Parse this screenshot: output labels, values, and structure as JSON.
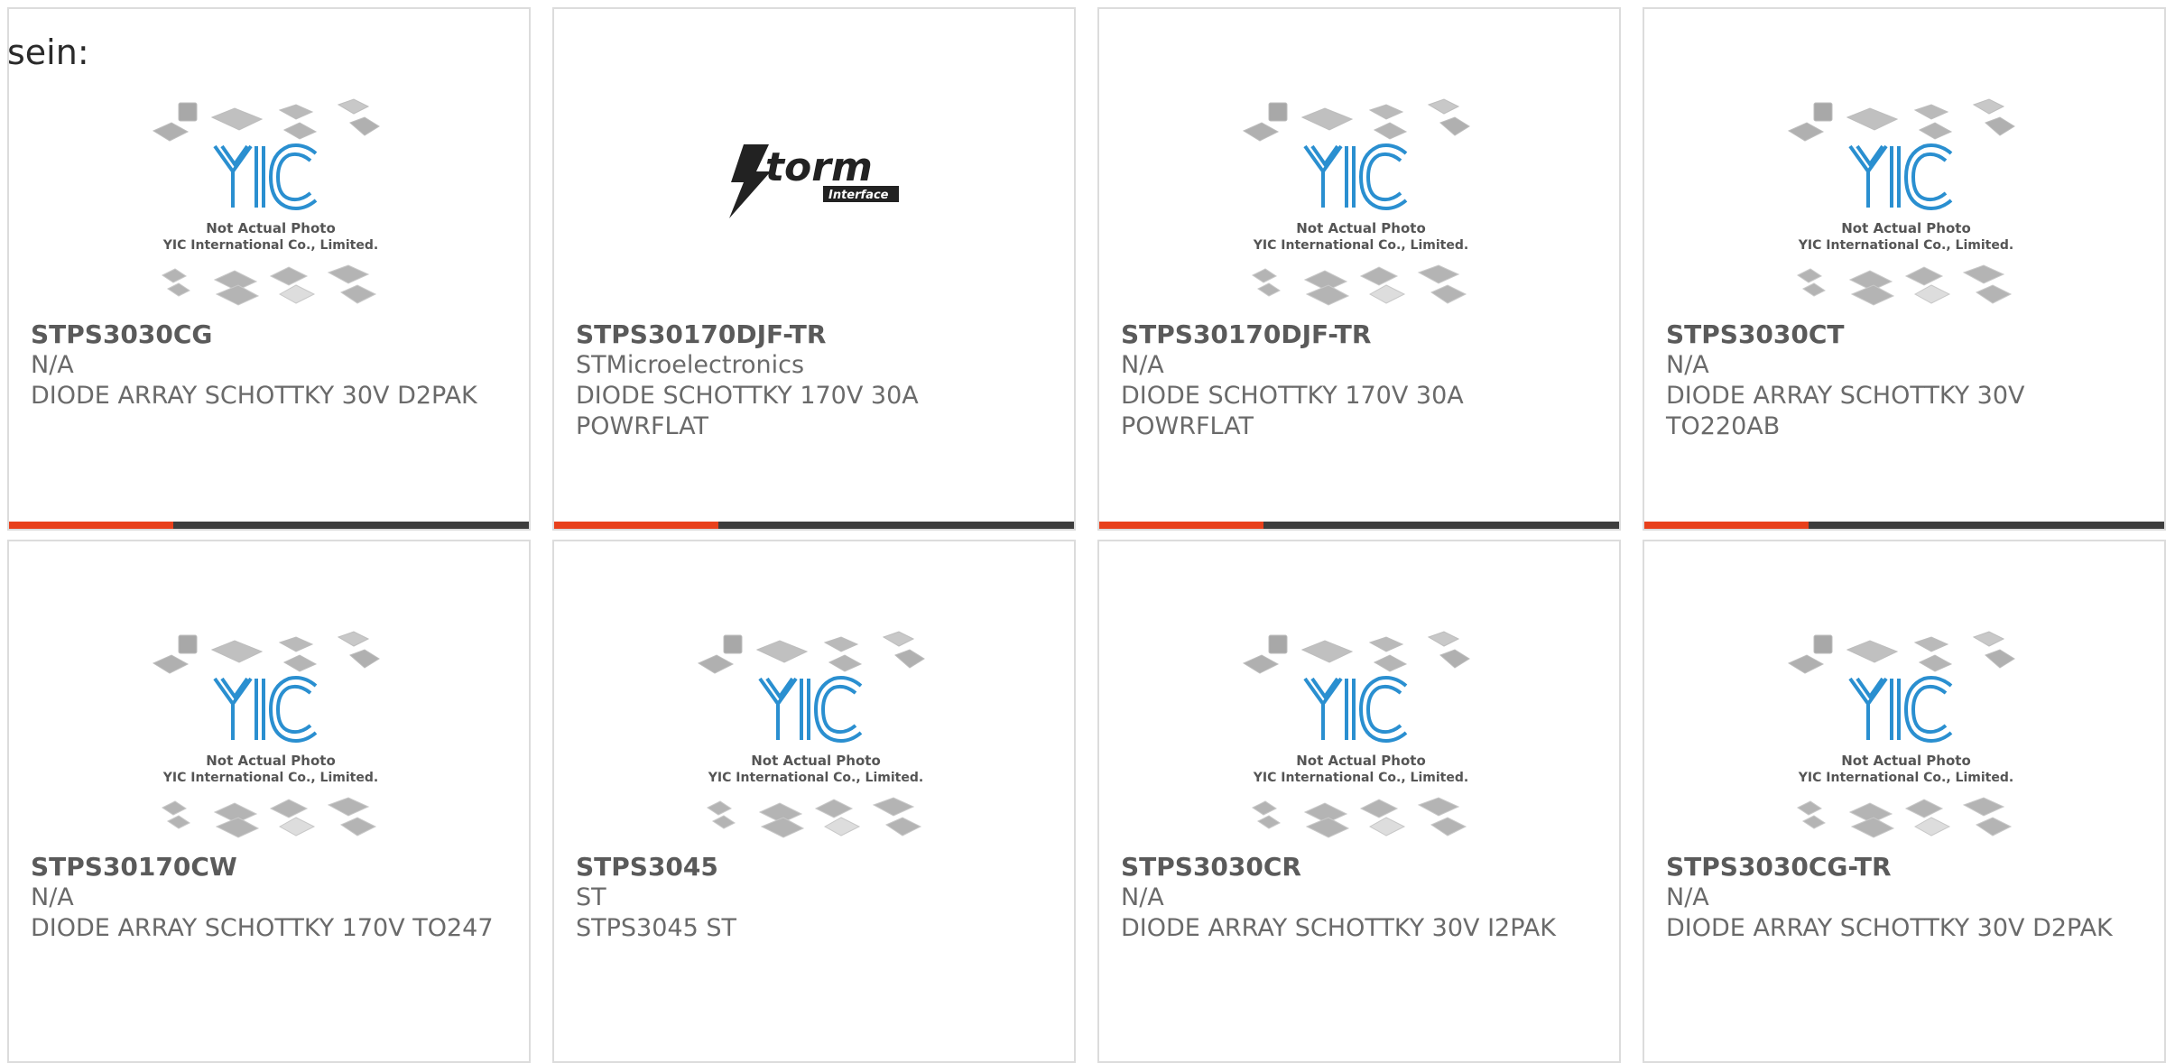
{
  "intro_text": "sein:",
  "products": [
    {
      "part": "STPS3030CG",
      "mfr": "N/A",
      "desc": "DIODE ARRAY SCHOTTKY 30V D2PAK",
      "image": "yic-placeholder"
    },
    {
      "part": "STPS30170DJF-TR",
      "mfr": "STMicroelectronics",
      "desc": "DIODE SCHOTTKY 170V 30A POWRFLAT",
      "image": "storm-logo"
    },
    {
      "part": "STPS30170DJF-TR",
      "mfr": "N/A",
      "desc": "DIODE SCHOTTKY 170V 30A POWRFLAT",
      "image": "yic-placeholder"
    },
    {
      "part": "STPS3030CT",
      "mfr": "N/A",
      "desc": "DIODE ARRAY SCHOTTKY 30V TO220AB",
      "image": "yic-placeholder"
    },
    {
      "part": "STPS30170CW",
      "mfr": "N/A",
      "desc": "DIODE ARRAY SCHOTTKY 170V TO247",
      "image": "yic-placeholder"
    },
    {
      "part": "STPS3045",
      "mfr": "ST",
      "desc": "STPS3045 ST",
      "image": "yic-placeholder"
    },
    {
      "part": "STPS3030CR",
      "mfr": "N/A",
      "desc": "DIODE ARRAY SCHOTTKY 30V I2PAK",
      "image": "yic-placeholder"
    },
    {
      "part": "STPS3030CG-TR",
      "mfr": "N/A",
      "desc": "DIODE ARRAY SCHOTTKY 30V D2PAK",
      "image": "yic-placeholder"
    }
  ],
  "placeholder": {
    "line1": "Not Actual Photo",
    "line2": "YIC International Co., Limited.",
    "logo_text": "YIC"
  },
  "storm_logo": {
    "main": "torm",
    "sub": "Interface"
  },
  "colors": {
    "accent": "#e8401c",
    "bar": "#3d3d3d",
    "yic_blue": "#2a8fd0"
  }
}
